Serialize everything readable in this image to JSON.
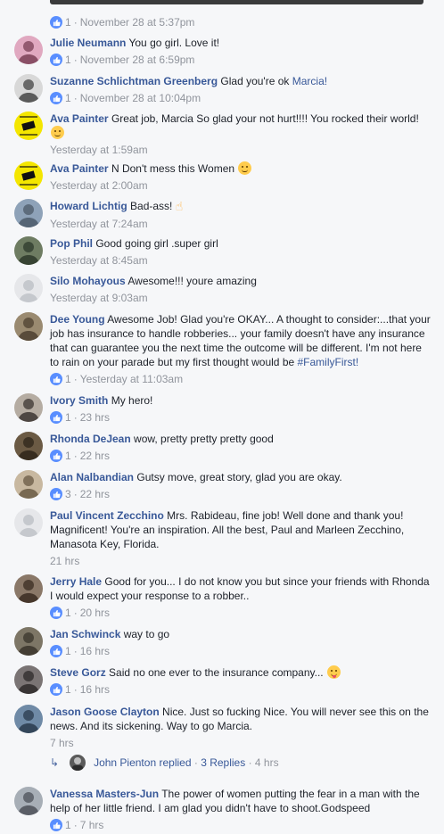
{
  "first_meta": {
    "likes": "1",
    "time": "November 28 at 5:37pm"
  },
  "comments": [
    {
      "author": "Julie Neumann",
      "text": "You go girl. Love it!",
      "likes": "1",
      "time": "November 28 at 6:59pm"
    },
    {
      "author": "Suzanne Schlichtman Greenberg",
      "text": "Glad you're ok ",
      "tag": "Marcia!",
      "likes": "1",
      "time": "November 28 at 10:04pm"
    },
    {
      "author": "Ava Painter",
      "text": "Great job, Marcia So glad your not hurt!!!! You rocked their world!",
      "time": "Yesterday at 1:59am"
    },
    {
      "author": "Ava Painter",
      "text": "N Don't mess this Women",
      "time": "Yesterday at 2:00am"
    },
    {
      "author": "Howard Lichtig",
      "text": "Bad-ass!",
      "time": "Yesterday at 7:24am"
    },
    {
      "author": "Pop Phil",
      "text": "Good going girl .super girl",
      "time": "Yesterday at 8:45am"
    },
    {
      "author": "Silo Mohayous",
      "text": "Awesome!!! youre amazing",
      "time": "Yesterday at 9:03am"
    },
    {
      "author": "Dee Young",
      "text": "Awesome Job! Glad you're OKAY... A thought to consider:...that your job has insurance to handle robberies... your family doesn't have any insurance that can guarantee you the next time the outcome will be different. I'm not here to rain on your parade but my first thought would be ",
      "tag": "#FamilyFirst!",
      "likes": "1",
      "time": "Yesterday at 11:03am"
    },
    {
      "author": "Ivory Smith",
      "text": "My hero!",
      "likes": "1",
      "time": "23 hrs"
    },
    {
      "author": "Rhonda DeJean",
      "text": "wow, pretty pretty pretty good",
      "likes": "1",
      "time": "22 hrs"
    },
    {
      "author": "Alan Nalbandian",
      "text": "Gutsy move, great story, glad you are okay.",
      "likes": "3",
      "time": "22 hrs"
    },
    {
      "author": "Paul Vincent Zecchino",
      "text": "Mrs. Rabideau, fine job! Well done and thank you! Magnificent! You're an inspiration. All the best, Paul and Marleen Zecchino, Manasota Key, Florida.",
      "time": "21 hrs"
    },
    {
      "author": "Jerry Hale",
      "text": "Good for you... I do not know you but since your friends with Rhonda I would expect your response to a robber..",
      "likes": "1",
      "time": "20 hrs"
    },
    {
      "author": "Jan Schwinck",
      "text": "way to go",
      "likes": "1",
      "time": "16 hrs"
    },
    {
      "author": "Steve Gorz",
      "text": "Said no one ever to the insurance company...",
      "likes": "1",
      "time": "16 hrs"
    },
    {
      "author": "Jason Goose Clayton",
      "text": "Nice. Just so fucking Nice. You will never see this on the news. And its sickening. Way to go Marcia.",
      "time": "7 hrs"
    },
    {
      "author": "Vanessa Masters-Jun",
      "text": "The power of women putting the fear in a man with the help of her little friend. I am glad you didn't have to shoot.Godspeed",
      "likes": "1",
      "time": "7 hrs"
    }
  ],
  "replies": {
    "author": "John Pienton",
    "replied": "replied",
    "count": "3 Replies",
    "time": "4 hrs"
  },
  "separator": "·",
  "colors": {
    "link": "#385898",
    "meta": "#90949c",
    "like_badge": "#598eff",
    "background": "#f6f7f9"
  }
}
